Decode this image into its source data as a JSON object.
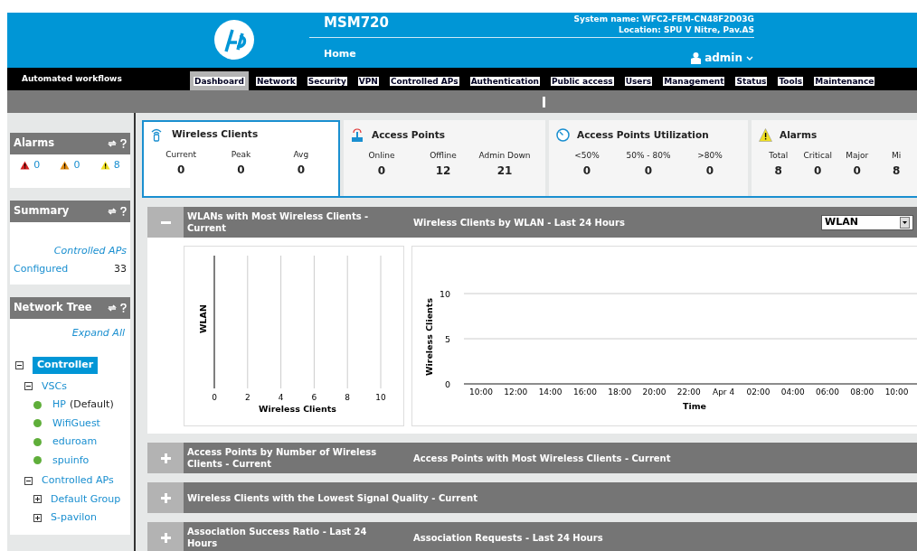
{
  "header": {
    "product": "MSM720",
    "home": "Home",
    "system_name": "System name: WFC2-FEM-CN48F2D03G",
    "location": "Location: SPU V Nitre, Pav.AS",
    "user": "admin"
  },
  "nav": {
    "workflows": "Automated workflows",
    "tabs": [
      {
        "label": "Dashboard",
        "selected": true
      },
      {
        "label": "Network",
        "selected": false
      },
      {
        "label": "Security",
        "selected": false
      },
      {
        "label": "VPN",
        "selected": false
      },
      {
        "label": "Controlled APs",
        "selected": false
      },
      {
        "label": "Authentication",
        "selected": false
      },
      {
        "label": "Public access",
        "selected": false
      },
      {
        "label": "Users",
        "selected": false
      },
      {
        "label": "Management",
        "selected": false
      },
      {
        "label": "Status",
        "selected": false
      },
      {
        "label": "Tools",
        "selected": false
      },
      {
        "label": "Maintenance",
        "selected": false
      }
    ]
  },
  "sidebar": {
    "alarms": {
      "title": "Alarms",
      "items": [
        {
          "count": "0",
          "color": "#d42020"
        },
        {
          "count": "0",
          "color": "#e08a10"
        },
        {
          "count": "8",
          "color": "#f0e020"
        }
      ]
    },
    "summary": {
      "title": "Summary",
      "heading": "Controlled APs",
      "rows": [
        {
          "label": "Configured",
          "value": "33"
        }
      ]
    },
    "network_tree": {
      "title": "Network Tree",
      "expand_all": "Expand All",
      "nodes": [
        {
          "label": "Controller",
          "kind": "group",
          "expanded": true,
          "selected": true,
          "children": [
            {
              "label": "VSCs",
              "kind": "group",
              "expanded": true,
              "selected": false,
              "children": [
                {
                  "label": "HP",
                  "note": "(Default)",
                  "kind": "vsc",
                  "selected": false
                },
                {
                  "label": "WifiGuest",
                  "kind": "vsc",
                  "selected": false
                },
                {
                  "label": "eduroam",
                  "kind": "vsc",
                  "selected": false
                },
                {
                  "label": "spuinfo",
                  "kind": "vsc",
                  "selected": false
                }
              ]
            },
            {
              "label": "Controlled APs",
              "kind": "group",
              "expanded": true,
              "selected": false,
              "children": [
                {
                  "label": "Default Group",
                  "kind": "group",
                  "expanded": false,
                  "selected": false
                },
                {
                  "label": "S-pavilon",
                  "kind": "group",
                  "expanded": false,
                  "selected": false
                }
              ]
            }
          ]
        }
      ]
    }
  },
  "stat_cards": [
    {
      "title": "Wireless Clients",
      "kind": "clients",
      "selected": true,
      "stats": [
        {
          "label": "Current",
          "value": "0"
        },
        {
          "label": "Peak",
          "value": "0"
        },
        {
          "label": "Avg",
          "value": "0"
        }
      ]
    },
    {
      "title": "Access Points",
      "kind": "aps",
      "selected": false,
      "stats": [
        {
          "label": "Online",
          "value": "0"
        },
        {
          "label": "Offline",
          "value": "12"
        },
        {
          "label": "Admin Down",
          "value": "21"
        }
      ]
    },
    {
      "title": "Access Points Utilization",
      "kind": "utilization",
      "selected": false,
      "stats": [
        {
          "label": "<50%",
          "value": "0"
        },
        {
          "label": "50% - 80%",
          "value": "0"
        },
        {
          "label": ">80%",
          "value": "0"
        }
      ]
    },
    {
      "title": "Alarms",
      "kind": "alarms",
      "selected": false,
      "stats": [
        {
          "label": "Total",
          "value": "8"
        },
        {
          "label": "Critical",
          "value": "0"
        },
        {
          "label": "Major",
          "value": "0"
        },
        {
          "label": "Mi",
          "value": "8"
        }
      ]
    }
  ],
  "panels": [
    {
      "expanded": true,
      "title_1": "WLANs with Most Wireless Clients - Current",
      "title_2": "Wireless Clients by WLAN - Last 24 Hours",
      "select": "WLAN",
      "chart_left": {
        "chart_data": {
          "type": "bar",
          "orientation": "horizontal",
          "categories": [
            null
          ],
          "values": [
            null
          ],
          "xlabel": "Wireless Clients",
          "ylabel": "WLAN",
          "xlim": [
            0,
            10
          ],
          "xticks": [
            0,
            2,
            4,
            6,
            8,
            10
          ],
          "grid": true
        }
      },
      "chart_right": {
        "chart_data": {
          "type": "line",
          "xlabel": "Time",
          "ylabel": "Wireless Clients",
          "ylim": [
            0,
            10
          ],
          "yticks": [
            0,
            5,
            10
          ],
          "grid": true,
          "categories": [
            "10:00",
            "12:00",
            "14:00",
            "16:00",
            "18:00",
            "20:00",
            "22:00",
            "Apr 4",
            "02:00",
            "04:00",
            "06:00",
            "08:00",
            "10:00"
          ]
        }
      }
    },
    {
      "expanded": false,
      "title_1": "Access Points by Number of Wireless Clients - Current",
      "title_2": "Access Points with Most Wireless Clients - Current"
    },
    {
      "expanded": false,
      "title_1": "Wireless Clients with the Lowest Signal Quality - Current"
    },
    {
      "expanded": false,
      "title_1": "Association Success Ratio - Last 24 Hours",
      "title_2": "Association Requests - Last 24 Hours"
    }
  ]
}
